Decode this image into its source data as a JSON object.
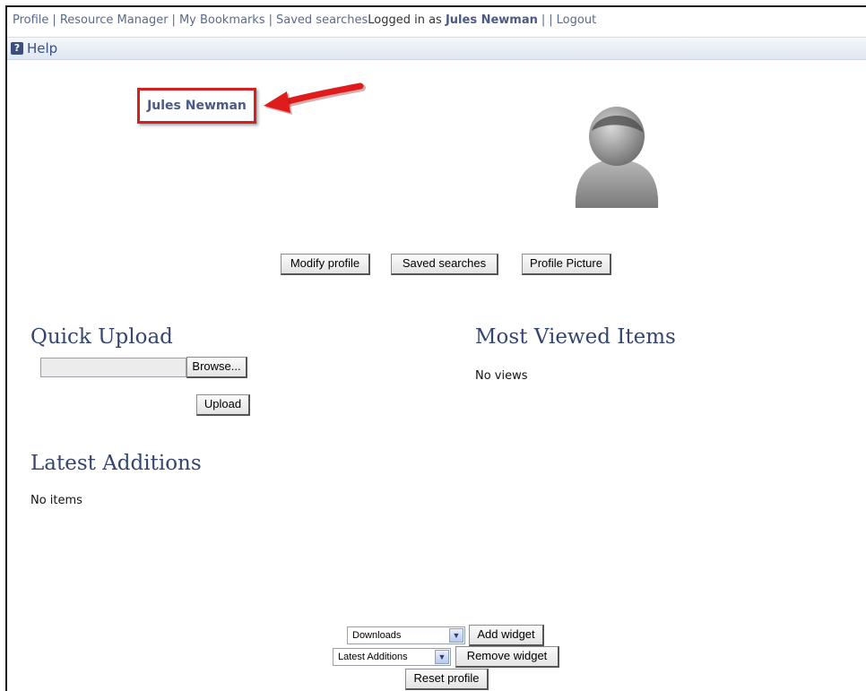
{
  "topnav": {
    "links": [
      "Profile",
      "Resource Manager",
      "My Bookmarks",
      "Saved searches"
    ],
    "logged_in_prefix": "Logged in as ",
    "user_name": "Jules Newman",
    "logout": "Logout"
  },
  "help": {
    "label": "Help"
  },
  "profile": {
    "name": "Jules Newman",
    "buttons": {
      "modify": "Modify profile",
      "saved": "Saved searches",
      "picture": "Profile Picture"
    }
  },
  "quick_upload": {
    "title": "Quick Upload",
    "browse": "Browse...",
    "upload": "Upload"
  },
  "most_viewed": {
    "title": "Most Viewed Items",
    "empty": "No views"
  },
  "latest_additions": {
    "title": "Latest Additions",
    "empty": "No items"
  },
  "widgets": {
    "add_select_value": "Downloads",
    "add_button": "Add widget",
    "remove_select_value": "Latest Additions",
    "remove_button": "Remove widget",
    "reset_button": "Reset profile"
  },
  "colors": {
    "link": "#5a6a8a",
    "heading": "#34456e",
    "highlight": "#d62020"
  }
}
